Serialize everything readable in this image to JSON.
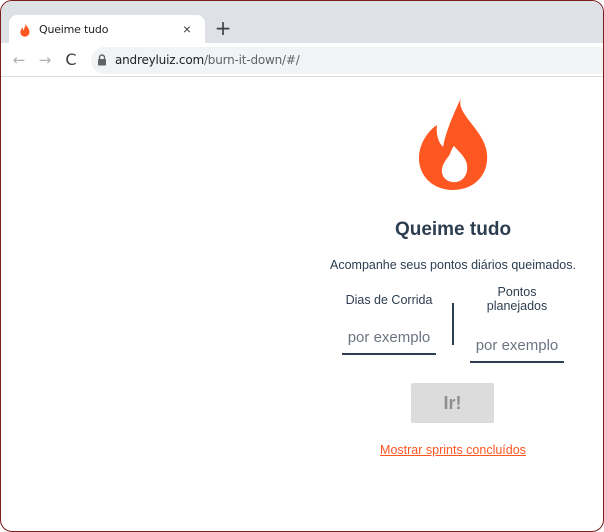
{
  "browser": {
    "tab": {
      "title": "Queime tudo",
      "close_label": "×",
      "favicon": "flame-icon"
    },
    "new_tab_label": "+",
    "nav": {
      "back": "←",
      "forward": "→",
      "reload": "C"
    },
    "url": {
      "host": "andreyluiz.com",
      "path": "/burn-it-down/#/"
    }
  },
  "page": {
    "logo": "flame-icon",
    "title": "Queime tudo",
    "subtitle": "Acompanhe seus pontos diários queimados.",
    "fields": [
      {
        "label": "Dias de Corrida",
        "value": "",
        "placeholder": "por exemplo"
      },
      {
        "label": "Pontos planejados",
        "value": "",
        "placeholder": "por exemplo"
      }
    ],
    "submit_label": "Ir!",
    "link_label": "Mostrar sprints concluídos"
  },
  "colors": {
    "accent": "#ff5722",
    "text": "#2c3e50",
    "button_disabled_bg": "#dcdcdc",
    "button_disabled_text": "#8f8f8f"
  }
}
